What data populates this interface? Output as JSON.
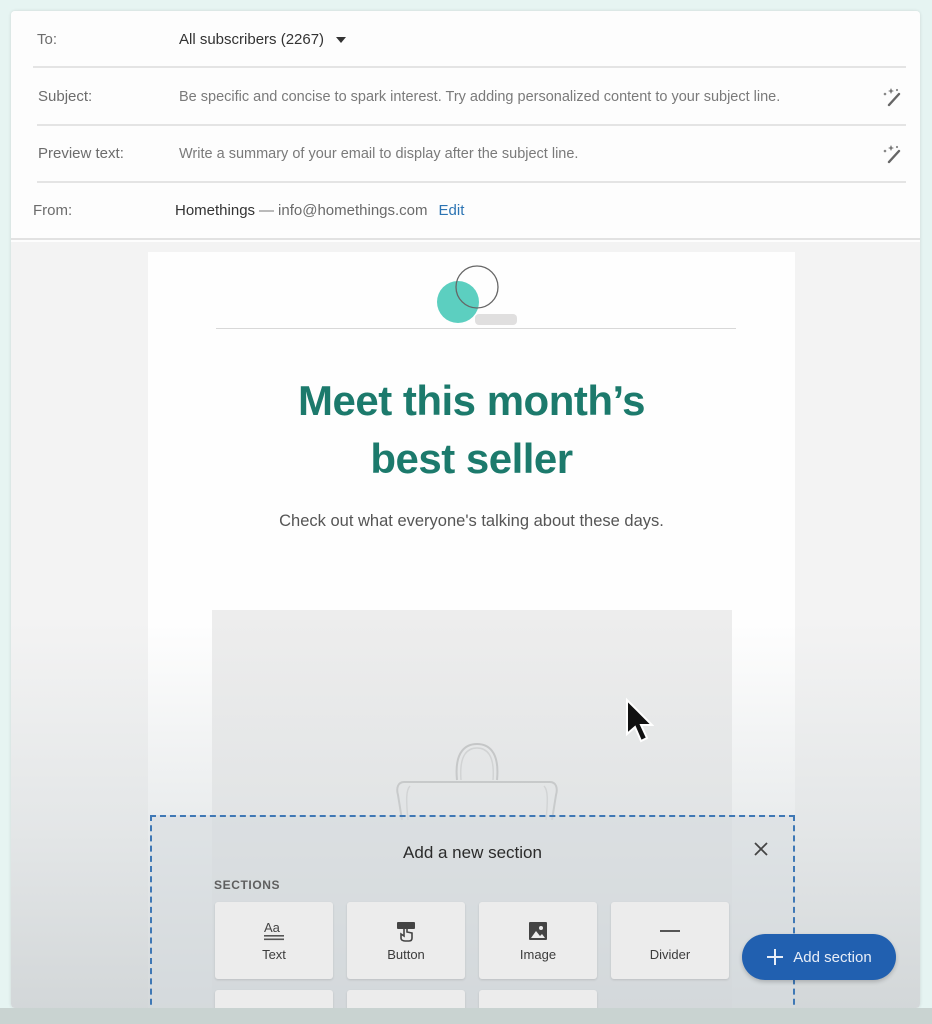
{
  "header": {
    "to": {
      "label": "To:",
      "value": "All subscribers (2267)"
    },
    "subject": {
      "label": "Subject:",
      "placeholder": "Be specific and concise to spark interest. Try adding personalized content to your subject line.",
      "ai_icon": "magic-wand-icon"
    },
    "preview": {
      "label": "Preview text:",
      "placeholder": "Write a summary of your email to display after the subject line.",
      "ai_icon": "magic-wand-icon"
    },
    "from": {
      "label": "From:",
      "name": "Homethings",
      "separator": "—",
      "email": "info@homethings.com",
      "edit_label": "Edit"
    }
  },
  "email": {
    "logo_icon": "brand-logo-circles",
    "headline_line1": "Meet this month’s",
    "headline_line2": "best seller",
    "subtext": "Check out what everyone's talking about these days.",
    "hero_icon": "bag-icon"
  },
  "panel": {
    "title": "Add a new section",
    "close_icon": "close-icon",
    "sections_label": "SECTIONS",
    "tiles": [
      {
        "label": "Text",
        "icon": "text-icon"
      },
      {
        "label": "Button",
        "icon": "button-icon"
      },
      {
        "label": "Image",
        "icon": "image-icon"
      },
      {
        "label": "Divider",
        "icon": "divider-icon"
      }
    ]
  },
  "fab": {
    "label": "Add section",
    "icon": "plus-icon"
  },
  "colors": {
    "accent": "#2160b0",
    "headline": "#1c7a6c",
    "logo_teal": "#5ccfc0",
    "link": "#2c74b3",
    "background": "#e6f4f2"
  }
}
